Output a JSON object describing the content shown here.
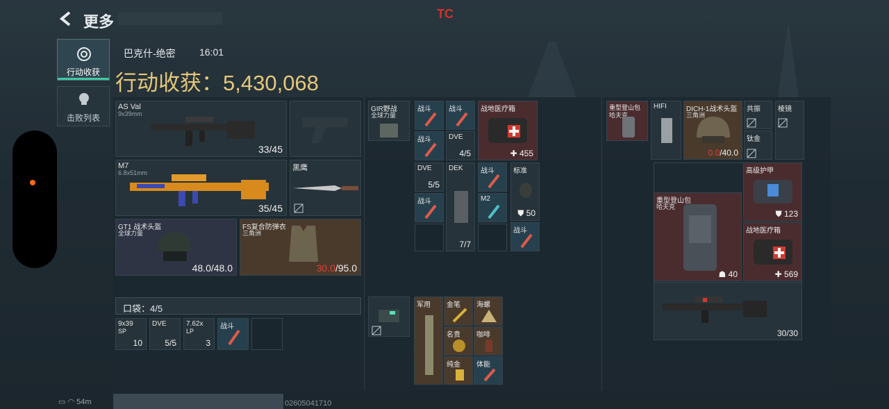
{
  "header": {
    "title": "更多",
    "tc_mark": "TC"
  },
  "sidebar": {
    "tab1_label": "行动收获",
    "tab2_label": "击败列表"
  },
  "info": {
    "map": "巴克什-绝密",
    "time": "16:01",
    "earnings_label": "行动收获：",
    "earnings_value": "5,430,068"
  },
  "loadout": {
    "primary": {
      "name": "AS Val",
      "ammo": "9x39mm",
      "count": "33/45"
    },
    "secondary": {
      "name": "M7",
      "ammo": "6.8x51mm",
      "count": "35/45"
    },
    "melee": {
      "name": "黑鹰"
    },
    "helmet": {
      "name": "GT1 战术头盔",
      "brand": "全球力量",
      "dur": "48.0/48.0"
    },
    "armor": {
      "name": "FS复合防弹衣",
      "brand": "三角洲",
      "dur_cur": "30.0",
      "dur_max": "/95.0"
    }
  },
  "pocket": {
    "label": "口袋：4/5",
    "items": [
      {
        "name": "9x39",
        "sub": "SP",
        "count": "10"
      },
      {
        "name": "DVE",
        "count": "5/5"
      },
      {
        "name": "7.62x",
        "sub": "LP",
        "count": "3"
      },
      {
        "name": "战斗"
      }
    ]
  },
  "chest_rig": {
    "name": "GIR野战",
    "brand": "全球力量"
  },
  "rig_items": {
    "a1": "战斗",
    "a2": "战斗",
    "a3": "战斗",
    "a4": "DVE",
    "a4_count": "4/5",
    "medkit": "战地医疗箱",
    "medkit_count": "455",
    "b1": "DVE",
    "b1_count": "5/5",
    "b2": "战斗",
    "dek": "DEK",
    "dek_count": "7/7",
    "c1": "战斗",
    "c2": "M2",
    "std": "标准",
    "std_count": "50",
    "c3": "战斗"
  },
  "case_items": {
    "case_label": "",
    "military": "军用",
    "gold": "金笔",
    "conch": "海螺",
    "famous": "名贵",
    "coffee": "咖啡",
    "pure": "纯金",
    "stamina": "体能"
  },
  "backpack_side": {
    "bag": "重型登山包",
    "bag_brand": "哈夫克",
    "hifi": "HIFI",
    "helmet": "DICH-1战术头盔",
    "helmet_brand": "三角洲",
    "helmet_dur_cur": "0.0",
    "helmet_dur_max": "/40.0",
    "resonator": "共振",
    "ti": "钛金",
    "prism": "棱镜"
  },
  "backpack": {
    "bag": "重型登山包",
    "bag_brand": "哈夫克",
    "bag_count": "40",
    "armor": "高级护甲",
    "armor_count": "123",
    "medkit": "战地医疗箱",
    "medkit_count": "569",
    "rifle_count": "30/30"
  },
  "status": {
    "network": "54m",
    "uid": "02605041710"
  }
}
